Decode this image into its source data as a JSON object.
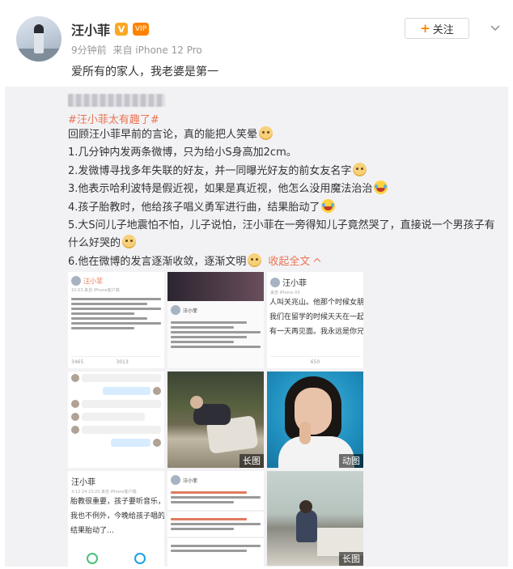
{
  "user": {
    "name": "汪小菲",
    "verified_badge": "V",
    "vip_badge": "VIP"
  },
  "post": {
    "time": "9分钟前",
    "source": "来自 iPhone 12 Pro",
    "text": "爱所有的家人，我老婆是第一"
  },
  "actions": {
    "follow_label": "关注",
    "follow_icon": "plus-icon",
    "more_icon": "chevron-down-icon"
  },
  "repost": {
    "hashtag": "#汪小菲太有趣了#",
    "lines": [
      "回顾汪小菲早前的言论，真的能把人笑晕",
      "1.几分钟内发两条微博，只为给小S身高加2cm。",
      "2.发微博寻找多年失联的好友，并一同曝光好友的前女友名字",
      "3.他表示哈利波特是假近视，如果是真近视，他怎么没用魔法治治",
      "4.孩子胎教时，他给孩子唱义勇军进行曲，结果胎动了",
      "5.大S问儿子地震怕不怕，儿子说怕，汪小菲在一旁得知儿子竟然哭了，直接说一个男孩子有什么好哭的",
      "6.他在微博的发言逐渐收敛，逐渐文明"
    ],
    "collapse_label": "收起全文"
  },
  "images": {
    "t1": {
      "name": "汪小菲",
      "meta": "10-03 来自 iPhone客户端",
      "foot_left": "3465",
      "foot_mid": "3013"
    },
    "t2": {
      "name": "汪小菲"
    },
    "t3": {
      "name": "汪小菲",
      "meta": "来自 iPhone XS",
      "snippet1": "人叫关兆山。他那个时候女朋友",
      "snippet2": "我们在留学的时候天天在一起，",
      "snippet3": "有一天再见面。我永远是你兄弟",
      "foot": "650"
    },
    "t5": {
      "tag": "长图"
    },
    "t6": {
      "tag": "动图"
    },
    "t7": {
      "name": "汪小菲",
      "meta": "3-12 24:23:20 来自 iPhone客户端",
      "snippet1": "胎教很重要，孩子要听音乐，爸",
      "snippet2": "我也不例外，今晚给孩子唱的是：",
      "snippet3": "结果胎动了…"
    },
    "t8": {
      "name": "汪小菲"
    },
    "t9": {
      "tag": "长图"
    }
  }
}
